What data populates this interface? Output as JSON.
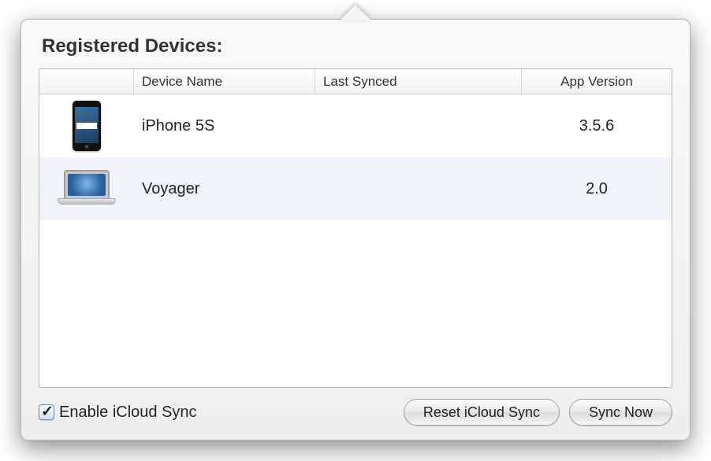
{
  "title": "Registered Devices:",
  "columns": {
    "icon": "",
    "name": "Device Name",
    "last_synced": "Last Synced",
    "app_version": "App Version"
  },
  "devices": [
    {
      "icon": "iphone",
      "name": "iPhone 5S",
      "last_synced": "",
      "app_version": "3.5.6"
    },
    {
      "icon": "macbook",
      "name": "Voyager",
      "last_synced": "",
      "app_version": "2.0"
    }
  ],
  "footer": {
    "enable_sync_label": "Enable iCloud Sync",
    "enable_sync_checked": true,
    "reset_button": "Reset iCloud Sync",
    "sync_now_button": "Sync Now"
  }
}
